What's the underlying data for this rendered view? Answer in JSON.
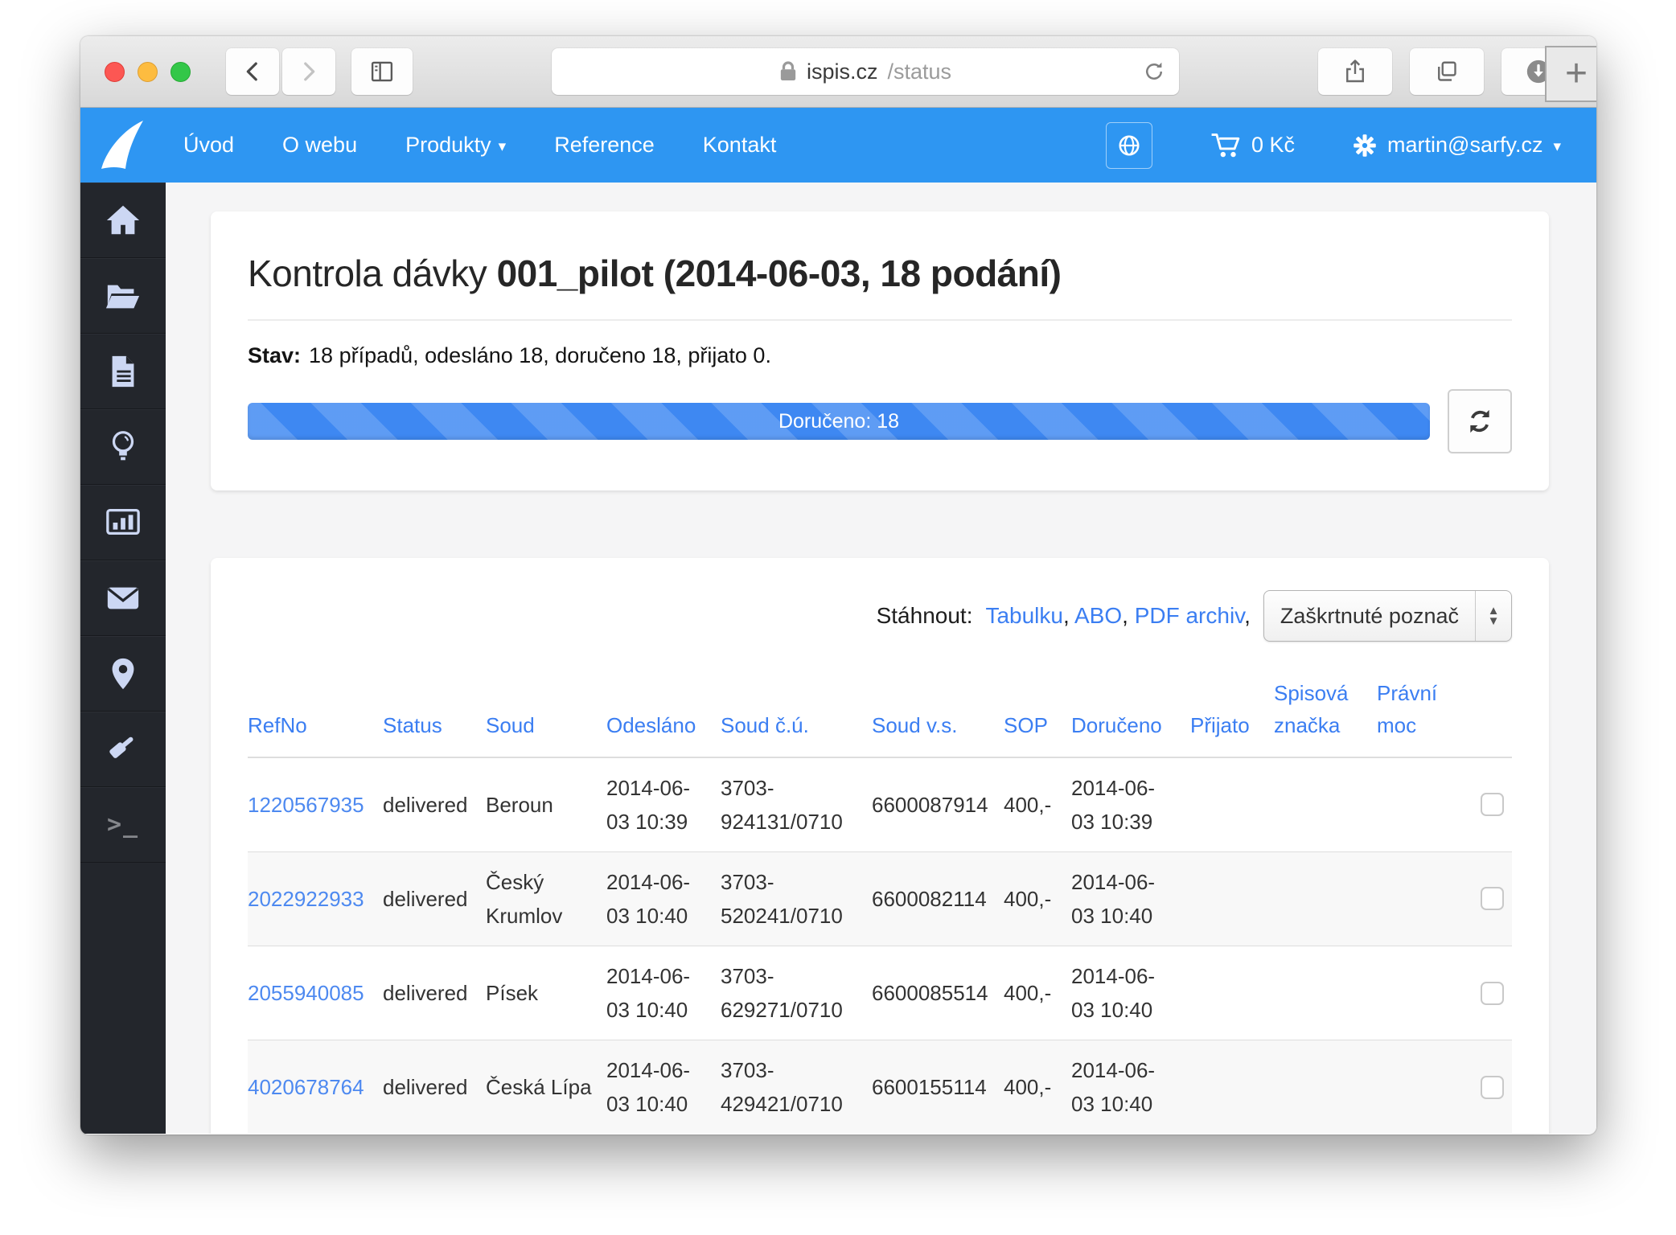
{
  "browser": {
    "url_host": "ispis.cz",
    "url_path": "/status",
    "window_controls": [
      "close-icon",
      "minimize-icon",
      "fullscreen-icon"
    ],
    "toolbar_icons": [
      "back-icon",
      "forward-icon",
      "sidebar-toggle-icon",
      "lock-icon",
      "reload-icon",
      "share-icon",
      "tab-overview-icon",
      "download-icon",
      "new-tab-plus"
    ]
  },
  "navbar": {
    "color": "#2e96f2",
    "links": [
      "Úvod",
      "O webu",
      "Produkty",
      "Reference",
      "Kontakt"
    ],
    "produkty_caret": "▾",
    "icons": [
      "globe-icon",
      "cart-icon",
      "gear-icon"
    ],
    "cart_label": "0 Kč",
    "account_email": "martin@sarfy.cz",
    "account_caret": "▾"
  },
  "sidebar": {
    "icons": [
      "home-icon",
      "folder-open-icon",
      "document-icon",
      "lightbulb-icon",
      "bar-chart-icon",
      "envelope-icon",
      "map-marker-icon",
      "gavel-icon",
      "terminal-icon"
    ],
    "terminal_glyph": ">_"
  },
  "page": {
    "title_light": "Kontrola dávky",
    "title_bold": "001_pilot (2014-06-03, 18 podání)",
    "status_label": "Stav:",
    "status_text": "18 případů, odesláno 18, doručeno 18, přijato 0.",
    "progress": {
      "label": "Doručeno: 18",
      "percent": 100,
      "bar_color": "#3e88f2"
    },
    "download": {
      "label": "Stáhnout:",
      "links": [
        "Tabulku",
        "ABO",
        "PDF archiv"
      ],
      "separator": ", ",
      "trailing_comma": ",",
      "select_value": "Zaškrtnuté poznač"
    }
  },
  "table": {
    "headers": [
      "RefNo",
      "Status",
      "Soud",
      "Odesláno",
      "Soud č.ú.",
      "Soud v.s.",
      "SOP",
      "Doručeno",
      "Přijato",
      "Spisová značka",
      "Právní moc",
      ""
    ],
    "rows": [
      [
        "1220567935",
        "delivered",
        "Beroun",
        "2014-06-\n03 10:39",
        "3703-\n924131/0710",
        "6600087914",
        "400,-",
        "2014-06-\n03 10:39",
        "",
        "",
        ""
      ],
      [
        "2022922933",
        "delivered",
        "Český\nKrumlov",
        "2014-06-\n03 10:40",
        "3703-\n520241/0710",
        "6600082114",
        "400,-",
        "2014-06-\n03 10:40",
        "",
        "",
        ""
      ],
      [
        "2055940085",
        "delivered",
        "Písek",
        "2014-06-\n03 10:40",
        "3703-\n629271/0710",
        "6600085514",
        "400,-",
        "2014-06-\n03 10:40",
        "",
        "",
        ""
      ],
      [
        "4020678764",
        "delivered",
        "Česká Lípa",
        "2014-06-\n03 10:40",
        "3703-\n429421/0710",
        "6600155114",
        "400,-",
        "2014-06-\n03 10:40",
        "",
        "",
        ""
      ]
    ]
  }
}
